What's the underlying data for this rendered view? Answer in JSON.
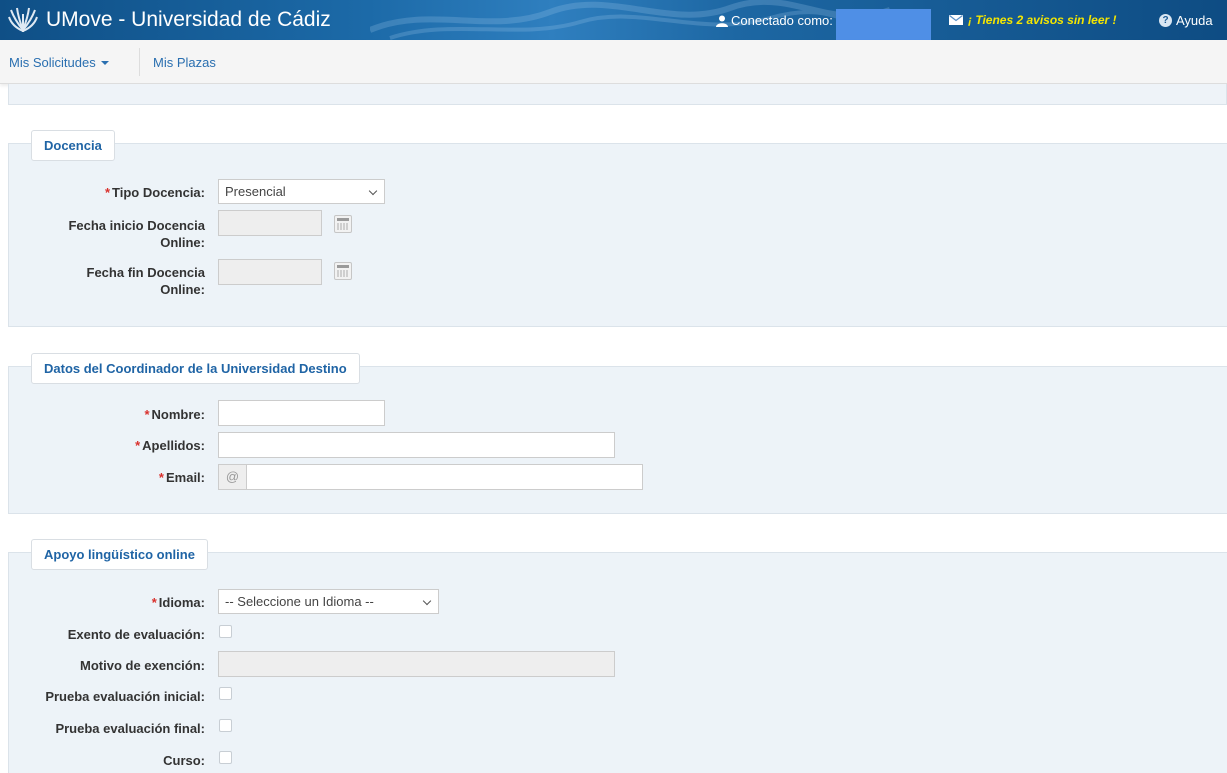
{
  "header": {
    "app_title": "UMove - Universidad de Cádiz",
    "connected_label": "Conectado como:",
    "notifications": "¡ Tienes 2 avisos sin leer !",
    "help": "Ayuda",
    "colors": {
      "header_blue": "#1c6aa8",
      "notice_yellow": "#f5e600",
      "user_box": "#4f8fe6"
    }
  },
  "nav": {
    "requests": "Mis Solicitudes",
    "places": "Mis Plazas"
  },
  "docencia": {
    "title": "Docencia",
    "tipo_label": "Tipo Docencia:",
    "tipo_value": "Presencial",
    "inicio_label_1": "Fecha inicio Docencia",
    "inicio_label_2": "Online:",
    "fin_label_1": "Fecha fin Docencia",
    "fin_label_2": "Online:"
  },
  "coordinador": {
    "title": "Datos del Coordinador de la Universidad Destino",
    "nombre_label": "Nombre:",
    "apellidos_label": "Apellidos:",
    "email_label": "Email:",
    "email_addon": "@"
  },
  "apoyo": {
    "title": "Apoyo lingüístico online",
    "idioma_label": "Idioma:",
    "idioma_value": "-- Seleccione un Idioma --",
    "exento_label": "Exento de evaluación:",
    "motivo_label": "Motivo de exención:",
    "inicial_label": "Prueba evaluación inicial:",
    "final_label": "Prueba evaluación final:",
    "curso_label": "Curso:"
  },
  "required_mark": "*"
}
